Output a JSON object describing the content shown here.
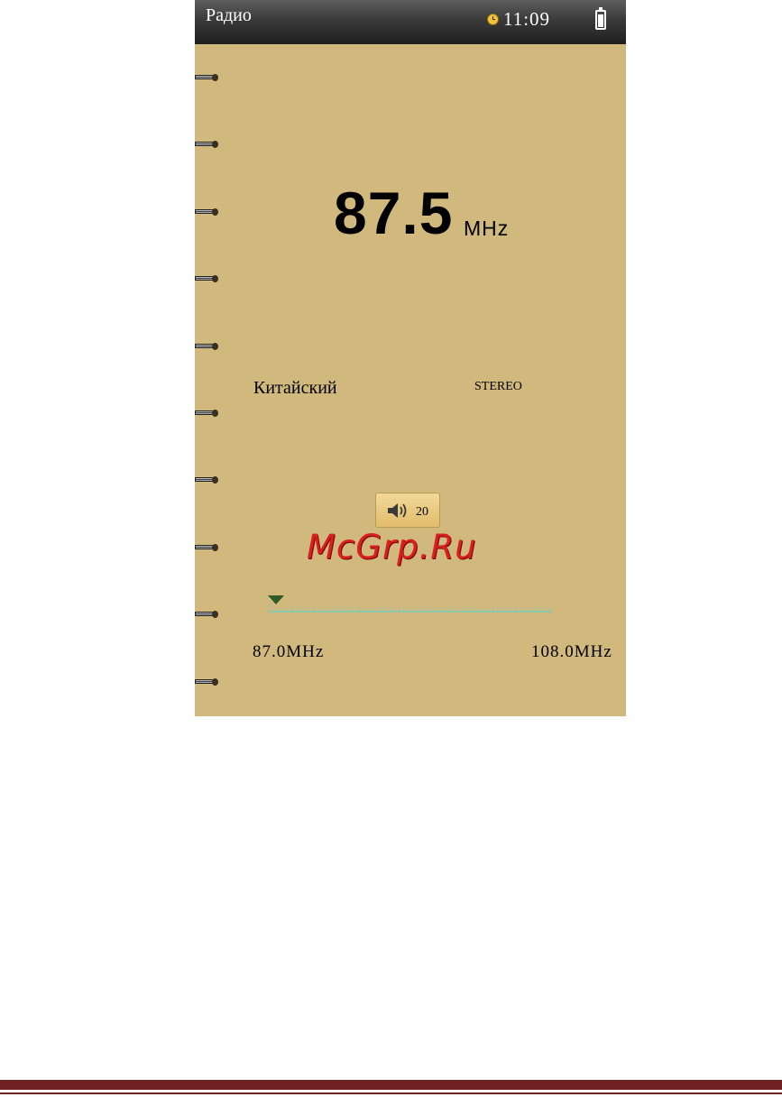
{
  "status_bar": {
    "title": "Радио",
    "time": "11:09",
    "clock_icon": "clock-icon",
    "battery_icon": "battery-icon"
  },
  "tuner": {
    "frequency": "87.5",
    "unit": "MHz",
    "station": "Китайский",
    "mode": "STEREO",
    "range_min": "87.0MHz",
    "range_max": "108.0MHz",
    "marker_position_fraction": 0.024
  },
  "volume": {
    "icon": "speaker-icon",
    "value": "20"
  },
  "watermark": "McGrp.Ru",
  "colors": {
    "background": "#d1b97e",
    "status_bar": "#2c2c2c",
    "marker": "#2f5a2a",
    "scale": "#7ecbb8",
    "watermark": "#d62020",
    "footer": "#6e2222"
  }
}
